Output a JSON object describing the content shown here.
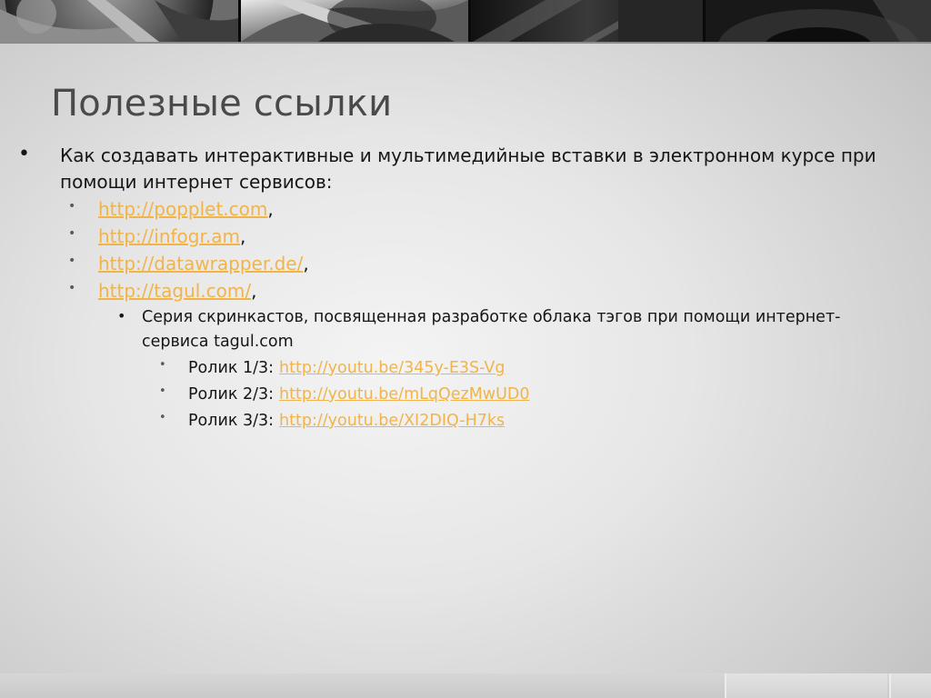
{
  "slide": {
    "title": "Полезные ссылки"
  },
  "bullets": {
    "main": "Как создавать интерактивные и мультимедийные вставки в электронном курсе при помощи интернет сервисов:",
    "links": [
      {
        "url": "http://popplet.com",
        "sep": ","
      },
      {
        "url": "http://infogr.am",
        "sep": ","
      },
      {
        "url": "http://datawrapper.de/",
        "sep": ","
      },
      {
        "url": "http://tagul.com/",
        "sep": ","
      }
    ],
    "series": "Серия скринкастов, посвященная разработке облака тэгов при помощи интернет-сервиса tagul.com",
    "videos": [
      {
        "label": "Ролик 1/3:",
        "url": "http://youtu.be/345y-E3S-Vg"
      },
      {
        "label": "Ролик 2/3:",
        "url": "http://youtu.be/mLqQezMwUD0"
      },
      {
        "label": "Ролик 3/3:",
        "url": "http://youtu.be/XI2DIQ-H7ks"
      }
    ]
  },
  "colors": {
    "title": "#4a4a4a",
    "text": "#161616",
    "link": "#f0b44a",
    "banner": "#1c1c1c"
  },
  "icons": {
    "bullet_main": "bullet-dot-icon",
    "bullet_sub": "bullet-dot-icon"
  }
}
